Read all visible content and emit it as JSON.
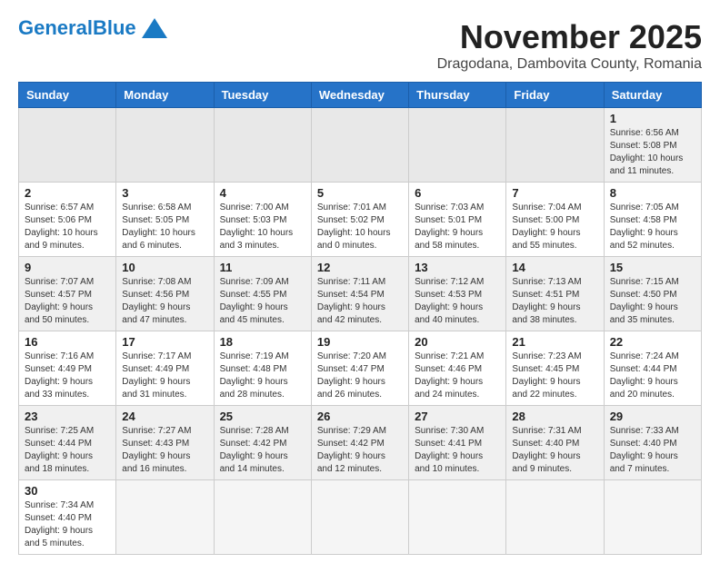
{
  "logo": {
    "general": "General",
    "blue": "Blue"
  },
  "title": "November 2025",
  "subtitle": "Dragodana, Dambovita County, Romania",
  "weekdays": [
    "Sunday",
    "Monday",
    "Tuesday",
    "Wednesday",
    "Thursday",
    "Friday",
    "Saturday"
  ],
  "weeks": [
    [
      {
        "day": "",
        "info": ""
      },
      {
        "day": "",
        "info": ""
      },
      {
        "day": "",
        "info": ""
      },
      {
        "day": "",
        "info": ""
      },
      {
        "day": "",
        "info": ""
      },
      {
        "day": "",
        "info": ""
      },
      {
        "day": "1",
        "info": "Sunrise: 6:56 AM\nSunset: 5:08 PM\nDaylight: 10 hours and 11 minutes."
      }
    ],
    [
      {
        "day": "2",
        "info": "Sunrise: 6:57 AM\nSunset: 5:06 PM\nDaylight: 10 hours and 9 minutes."
      },
      {
        "day": "3",
        "info": "Sunrise: 6:58 AM\nSunset: 5:05 PM\nDaylight: 10 hours and 6 minutes."
      },
      {
        "day": "4",
        "info": "Sunrise: 7:00 AM\nSunset: 5:03 PM\nDaylight: 10 hours and 3 minutes."
      },
      {
        "day": "5",
        "info": "Sunrise: 7:01 AM\nSunset: 5:02 PM\nDaylight: 10 hours and 0 minutes."
      },
      {
        "day": "6",
        "info": "Sunrise: 7:03 AM\nSunset: 5:01 PM\nDaylight: 9 hours and 58 minutes."
      },
      {
        "day": "7",
        "info": "Sunrise: 7:04 AM\nSunset: 5:00 PM\nDaylight: 9 hours and 55 minutes."
      },
      {
        "day": "8",
        "info": "Sunrise: 7:05 AM\nSunset: 4:58 PM\nDaylight: 9 hours and 52 minutes."
      }
    ],
    [
      {
        "day": "9",
        "info": "Sunrise: 7:07 AM\nSunset: 4:57 PM\nDaylight: 9 hours and 50 minutes."
      },
      {
        "day": "10",
        "info": "Sunrise: 7:08 AM\nSunset: 4:56 PM\nDaylight: 9 hours and 47 minutes."
      },
      {
        "day": "11",
        "info": "Sunrise: 7:09 AM\nSunset: 4:55 PM\nDaylight: 9 hours and 45 minutes."
      },
      {
        "day": "12",
        "info": "Sunrise: 7:11 AM\nSunset: 4:54 PM\nDaylight: 9 hours and 42 minutes."
      },
      {
        "day": "13",
        "info": "Sunrise: 7:12 AM\nSunset: 4:53 PM\nDaylight: 9 hours and 40 minutes."
      },
      {
        "day": "14",
        "info": "Sunrise: 7:13 AM\nSunset: 4:51 PM\nDaylight: 9 hours and 38 minutes."
      },
      {
        "day": "15",
        "info": "Sunrise: 7:15 AM\nSunset: 4:50 PM\nDaylight: 9 hours and 35 minutes."
      }
    ],
    [
      {
        "day": "16",
        "info": "Sunrise: 7:16 AM\nSunset: 4:49 PM\nDaylight: 9 hours and 33 minutes."
      },
      {
        "day": "17",
        "info": "Sunrise: 7:17 AM\nSunset: 4:49 PM\nDaylight: 9 hours and 31 minutes."
      },
      {
        "day": "18",
        "info": "Sunrise: 7:19 AM\nSunset: 4:48 PM\nDaylight: 9 hours and 28 minutes."
      },
      {
        "day": "19",
        "info": "Sunrise: 7:20 AM\nSunset: 4:47 PM\nDaylight: 9 hours and 26 minutes."
      },
      {
        "day": "20",
        "info": "Sunrise: 7:21 AM\nSunset: 4:46 PM\nDaylight: 9 hours and 24 minutes."
      },
      {
        "day": "21",
        "info": "Sunrise: 7:23 AM\nSunset: 4:45 PM\nDaylight: 9 hours and 22 minutes."
      },
      {
        "day": "22",
        "info": "Sunrise: 7:24 AM\nSunset: 4:44 PM\nDaylight: 9 hours and 20 minutes."
      }
    ],
    [
      {
        "day": "23",
        "info": "Sunrise: 7:25 AM\nSunset: 4:44 PM\nDaylight: 9 hours and 18 minutes."
      },
      {
        "day": "24",
        "info": "Sunrise: 7:27 AM\nSunset: 4:43 PM\nDaylight: 9 hours and 16 minutes."
      },
      {
        "day": "25",
        "info": "Sunrise: 7:28 AM\nSunset: 4:42 PM\nDaylight: 9 hours and 14 minutes."
      },
      {
        "day": "26",
        "info": "Sunrise: 7:29 AM\nSunset: 4:42 PM\nDaylight: 9 hours and 12 minutes."
      },
      {
        "day": "27",
        "info": "Sunrise: 7:30 AM\nSunset: 4:41 PM\nDaylight: 9 hours and 10 minutes."
      },
      {
        "day": "28",
        "info": "Sunrise: 7:31 AM\nSunset: 4:40 PM\nDaylight: 9 hours and 9 minutes."
      },
      {
        "day": "29",
        "info": "Sunrise: 7:33 AM\nSunset: 4:40 PM\nDaylight: 9 hours and 7 minutes."
      }
    ],
    [
      {
        "day": "30",
        "info": "Sunrise: 7:34 AM\nSunset: 4:40 PM\nDaylight: 9 hours and 5 minutes."
      },
      {
        "day": "",
        "info": ""
      },
      {
        "day": "",
        "info": ""
      },
      {
        "day": "",
        "info": ""
      },
      {
        "day": "",
        "info": ""
      },
      {
        "day": "",
        "info": ""
      },
      {
        "day": "",
        "info": ""
      }
    ]
  ]
}
